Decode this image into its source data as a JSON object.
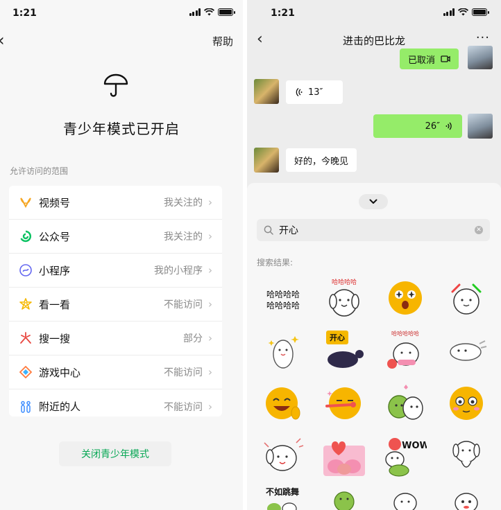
{
  "left": {
    "status_time": "1:21",
    "nav_help": "帮助",
    "mode_title": "青少年模式已开启",
    "section_label": "允许访问的范围",
    "rows": [
      {
        "label": "视频号",
        "value": "我关注的",
        "icon": "channels-icon",
        "color": "#f5a623"
      },
      {
        "label": "公众号",
        "value": "我关注的",
        "icon": "official-accounts-icon",
        "color": "#07c160"
      },
      {
        "label": "小程序",
        "value": "我的小程序",
        "icon": "mini-program-icon",
        "color": "#6467f0"
      },
      {
        "label": "看一看",
        "value": "不能访问",
        "icon": "top-stories-icon",
        "color": "#f5b800"
      },
      {
        "label": "搜一搜",
        "value": "部分",
        "icon": "search-feature-icon",
        "color": "#e8463f"
      },
      {
        "label": "游戏中心",
        "value": "不能访问",
        "icon": "game-center-icon",
        "color": "#ff7a3d"
      },
      {
        "label": "附近的人",
        "value": "不能访问",
        "icon": "people-nearby-icon",
        "color": "#3b8cff"
      }
    ],
    "close_button": "关闭青少年模式",
    "accent_color": "#07a754"
  },
  "right": {
    "status_time": "1:21",
    "chat_title": "进击的巴比龙",
    "messages": [
      {
        "side": "out",
        "text": "已取消"
      },
      {
        "side": "in",
        "text": "13″"
      },
      {
        "side": "out",
        "text": "26″"
      },
      {
        "side": "in",
        "text": "好的，今晚见"
      }
    ],
    "search_query": "开心",
    "results_label": "搜索结果:",
    "stickers": [
      "哈哈哈哈",
      "哈哈哈哈",
      "",
      "",
      "",
      "开心",
      "哈哈哈哈哈",
      "",
      "",
      "",
      "",
      "",
      "",
      "",
      "WOW",
      "",
      "不如跳舞",
      "",
      "",
      ""
    ],
    "bubble_out_color": "#95ec69",
    "bubble_in_color": "#ffffff"
  }
}
